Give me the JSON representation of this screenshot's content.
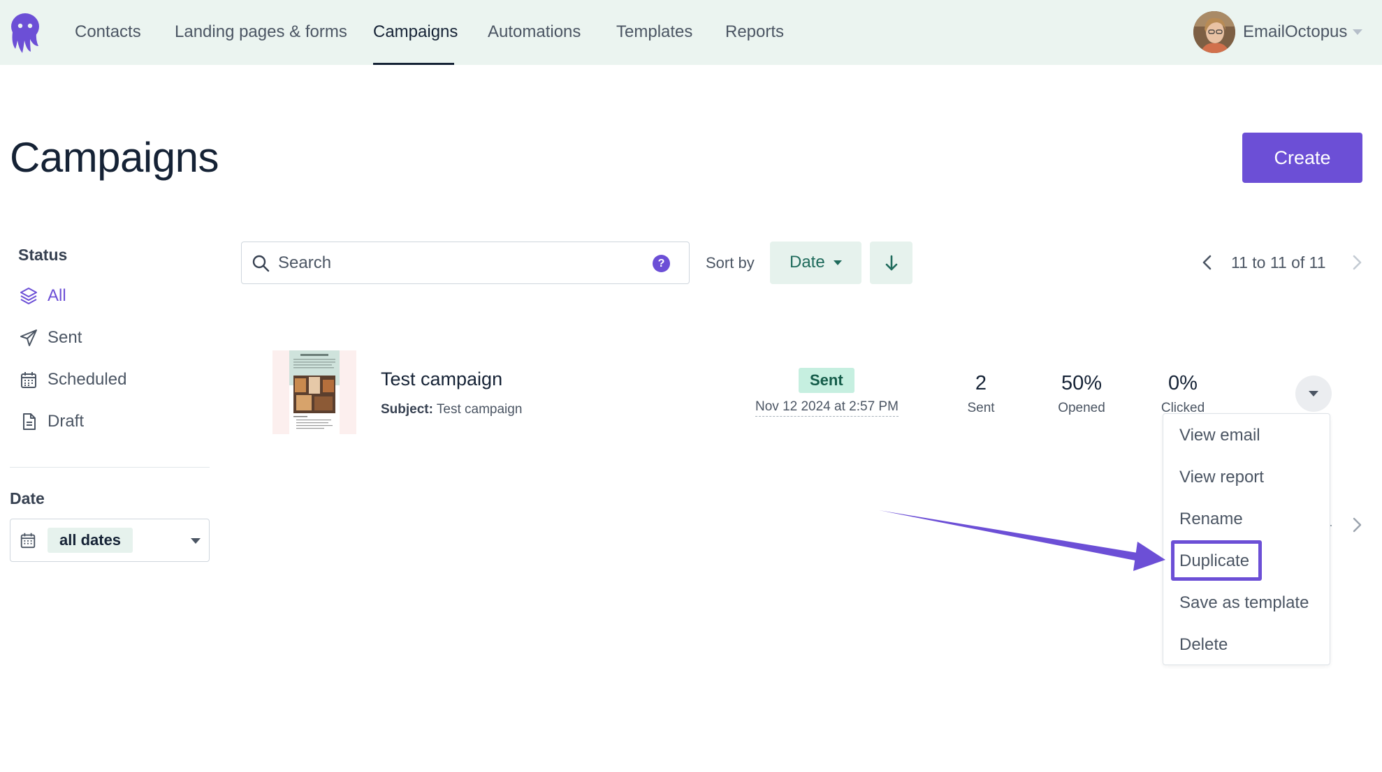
{
  "nav": {
    "items": [
      {
        "label": "Contacts"
      },
      {
        "label": "Landing pages & forms"
      },
      {
        "label": "Campaigns"
      },
      {
        "label": "Automations"
      },
      {
        "label": "Templates"
      },
      {
        "label": "Reports"
      }
    ],
    "active": "Campaigns",
    "account_name": "EmailOctopus"
  },
  "header": {
    "title": "Campaigns",
    "create_label": "Create"
  },
  "sidebar": {
    "status_heading": "Status",
    "status_items": [
      {
        "label": "All",
        "icon": "layers-icon",
        "active": true
      },
      {
        "label": "Sent",
        "icon": "paper-plane-icon"
      },
      {
        "label": "Scheduled",
        "icon": "calendar-icon"
      },
      {
        "label": "Draft",
        "icon": "document-icon"
      }
    ],
    "date_heading": "Date",
    "date_value": "all dates"
  },
  "toolbar": {
    "search_placeholder": "Search",
    "help_glyph": "?",
    "sort_label": "Sort by",
    "sort_value": "Date",
    "pagination": "11 to 11 of 11"
  },
  "campaign": {
    "name": "Test campaign",
    "subject_label": "Subject:",
    "subject": "Test campaign",
    "status": "Sent",
    "sent_at": "Nov 12 2024 at 2:57 PM",
    "stats": [
      {
        "value": "2",
        "label": "Sent"
      },
      {
        "value": "50%",
        "label": "Opened"
      },
      {
        "value": "0%",
        "label": "Clicked"
      }
    ]
  },
  "row_menu": {
    "items": [
      {
        "label": "View email"
      },
      {
        "label": "View report"
      },
      {
        "label": "Rename"
      },
      {
        "label": "Duplicate",
        "highlighted": true
      },
      {
        "label": "Save as template"
      },
      {
        "label": "Delete"
      }
    ]
  },
  "colors": {
    "brand": "#6c4fd6",
    "nav_bg": "#ebf4f0",
    "sent_badge_bg": "#c6efe0",
    "sort_button_bg": "#e6f2ed"
  }
}
